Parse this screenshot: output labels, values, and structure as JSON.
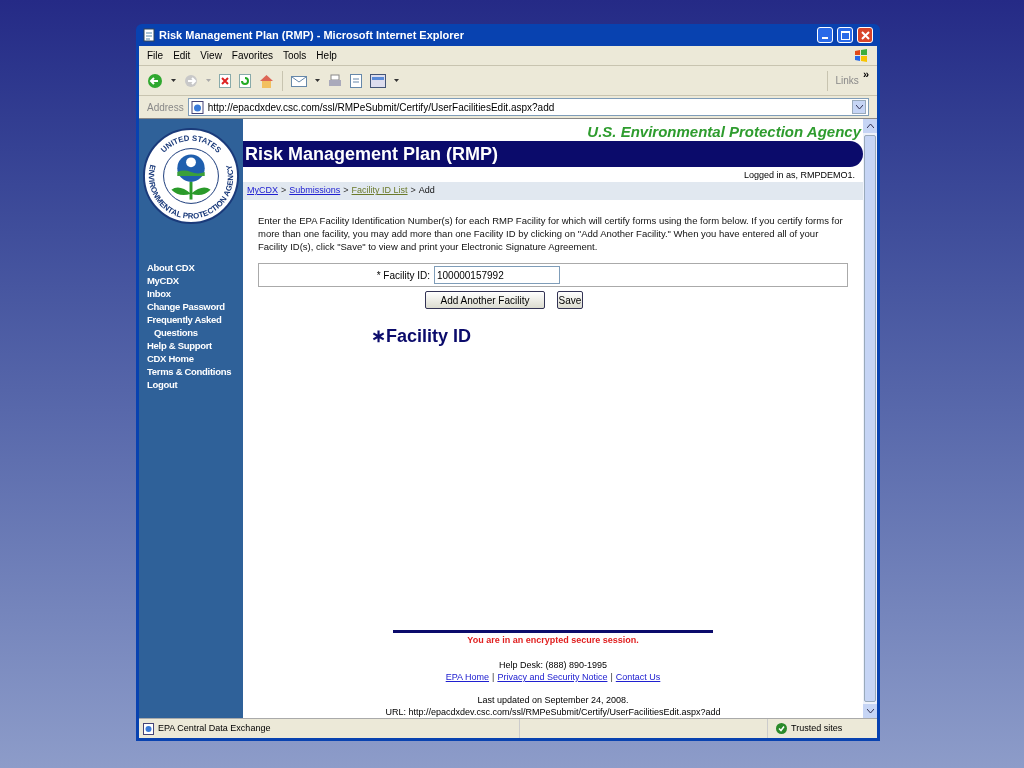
{
  "window": {
    "title": "Risk Management Plan (RMP) - Microsoft Internet Explorer"
  },
  "menu": [
    "File",
    "Edit",
    "View",
    "Favorites",
    "Tools",
    "Help"
  ],
  "toolbar": {
    "links_label": "Links",
    "overflow": "»"
  },
  "address": {
    "label": "Address",
    "url": "http://epacdxdev.csc.com/ssl/RMPeSubmit/Certify/UserFacilitiesEdit.aspx?add"
  },
  "sidebar": {
    "seal_top": "UNITED STATES",
    "seal_bottom": "ENVIRONMENTAL PROTECTION AGENCY",
    "items": [
      "About CDX",
      "MyCDX",
      "Inbox",
      "Change Password",
      "Frequently Asked Questions",
      "Help & Support",
      "CDX Home",
      "Terms & Conditions",
      "Logout"
    ]
  },
  "page": {
    "agency": "U.S. Environmental Protection Agency",
    "banner": "Risk Management Plan (RMP)",
    "logged_in": "Logged in as, RMPDEMO1.",
    "breadcrumb": [
      {
        "label": "MyCDX",
        "kind": "link"
      },
      {
        "label": ">",
        "kind": "separator"
      },
      {
        "label": "Submissions",
        "kind": "link"
      },
      {
        "label": ">",
        "kind": "separator"
      },
      {
        "label": "Facility ID List",
        "kind": "visited"
      },
      {
        "label": ">",
        "kind": "separator"
      },
      {
        "label": "Add",
        "kind": "current"
      }
    ],
    "intro": "Enter the EPA Facility Identification Number(s) for each RMP Facility for which will certify forms using the form below. If you certify forms for more than one facility, you may add more than one Facility ID by clicking on \"Add Another Facility.\" When you have entered all of your Facility ID(s), click \"Save\" to view and print your Electronic Signature Agreement.",
    "field_label": "* Facility ID:",
    "field_value": "100000157992",
    "buttons": [
      "Add Another Facility",
      "Save"
    ],
    "annotation": "∗Facility ID",
    "secure": "You are in an encrypted secure session.",
    "help_desk": "Help Desk: (888) 890-1995",
    "footer_links": [
      {
        "label": "EPA Home",
        "kind": "link"
      },
      {
        "label": "|",
        "kind": "separator"
      },
      {
        "label": "Privacy and Security Notice",
        "kind": "link"
      },
      {
        "label": "|",
        "kind": "separator"
      },
      {
        "label": "Contact Us",
        "kind": "link"
      }
    ],
    "updated": "Last updated on September 24, 2008.",
    "url_line": "URL: http://epacdxdev.csc.com/ssl/RMPeSubmit/Certify/UserFacilitiesEdit.aspx?add"
  },
  "status_bar": {
    "text": "EPA Central Data Exchange",
    "zone": "Trusted sites"
  }
}
